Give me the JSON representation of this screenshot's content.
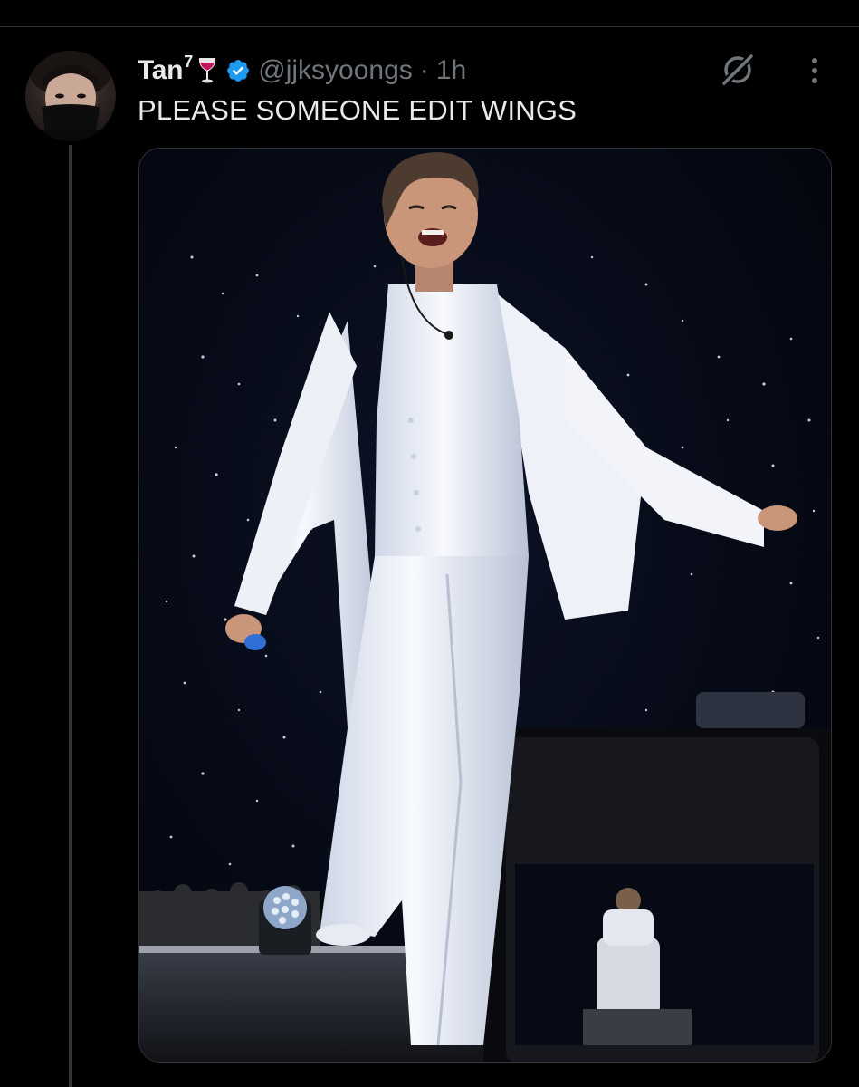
{
  "tweet": {
    "author": {
      "display_name": "Tan",
      "name_superscript": "7",
      "name_emoji": "wine-glass-icon",
      "verified": true,
      "handle": "@jjksyoongs"
    },
    "separator": "·",
    "timestamp": "1h",
    "text": "PLEASE SOMEONE EDIT WINGS",
    "media": {
      "type": "photo"
    }
  },
  "icons": {
    "grok": "grok-icon",
    "more": "more-options-icon",
    "verified": "verified-badge-icon",
    "wine": "wine-glass-icon"
  },
  "colors": {
    "background": "#000000",
    "text_primary": "#e7e9ea",
    "text_secondary": "#71767b",
    "verified_blue": "#1d9bf0",
    "divider": "#2f3336"
  }
}
